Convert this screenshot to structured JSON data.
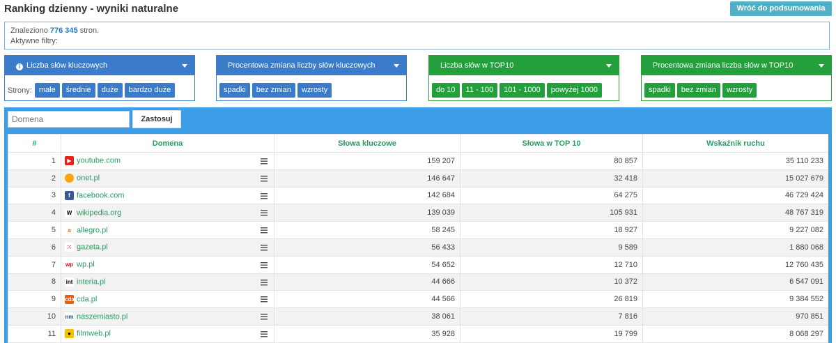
{
  "header": {
    "title": "Ranking dzienny - wyniki naturalne",
    "back_label": "Wróć do podsumowania"
  },
  "info": {
    "found_prefix": "Znaleziono ",
    "found_count": "776 345",
    "found_suffix": " stron.",
    "filters_label": "Aktywne filtry:"
  },
  "filters": [
    {
      "title": "Liczba słów kluczowych",
      "has_info": true,
      "prefix": "Strony:",
      "options": [
        "małe",
        "średnie",
        "duże",
        "bardzo duże"
      ]
    },
    {
      "title": "Procentowa zmiana liczby słów kluczowych",
      "has_info": false,
      "prefix": "",
      "options": [
        "spadki",
        "bez zmian",
        "wzrosty"
      ]
    },
    {
      "title": "Liczba słów w TOP10",
      "has_info": false,
      "prefix": "",
      "options": [
        "do 10",
        "11 - 100",
        "101 - 1000",
        "powyżej 1000"
      ]
    },
    {
      "title": "Procentowa zmiana liczba słów w TOP10",
      "has_info": false,
      "prefix": "",
      "options": [
        "spadki",
        "bez zmian",
        "wzrosty"
      ]
    }
  ],
  "search": {
    "placeholder": "Domena",
    "apply_label": "Zastosuj"
  },
  "table": {
    "columns": [
      "#",
      "Domena",
      "Słowa kluczowe",
      "Słowa w TOP 10",
      "Wskaźnik ruchu"
    ],
    "rows": [
      {
        "rank": "1",
        "domain": "youtube.com",
        "icon": "youtube-icon",
        "keywords": "159 207",
        "top10": "80 857",
        "traffic": "35 110 233"
      },
      {
        "rank": "2",
        "domain": "onet.pl",
        "icon": "onet-icon",
        "keywords": "146 647",
        "top10": "32 418",
        "traffic": "15 027 679"
      },
      {
        "rank": "3",
        "domain": "facebook.com",
        "icon": "facebook-icon",
        "keywords": "142 684",
        "top10": "64 275",
        "traffic": "46 729 424"
      },
      {
        "rank": "4",
        "domain": "wikipedia.org",
        "icon": "wikipedia-icon",
        "keywords": "139 039",
        "top10": "105 931",
        "traffic": "48 767 319"
      },
      {
        "rank": "5",
        "domain": "allegro.pl",
        "icon": "allegro-icon",
        "keywords": "58 245",
        "top10": "18 927",
        "traffic": "9 227 082"
      },
      {
        "rank": "6",
        "domain": "gazeta.pl",
        "icon": "gazeta-icon",
        "keywords": "56 433",
        "top10": "9 589",
        "traffic": "1 880 068"
      },
      {
        "rank": "7",
        "domain": "wp.pl",
        "icon": "wp-icon",
        "keywords": "54 652",
        "top10": "12 710",
        "traffic": "12 760 435"
      },
      {
        "rank": "8",
        "domain": "interia.pl",
        "icon": "interia-icon",
        "keywords": "44 666",
        "top10": "10 372",
        "traffic": "6 547 091"
      },
      {
        "rank": "9",
        "domain": "cda.pl",
        "icon": "cda-icon",
        "keywords": "44 566",
        "top10": "26 819",
        "traffic": "9 384 552"
      },
      {
        "rank": "10",
        "domain": "naszemiasto.pl",
        "icon": "naszemiasto-icon",
        "keywords": "38 061",
        "top10": "7 816",
        "traffic": "970 851"
      },
      {
        "rank": "11",
        "domain": "filmweb.pl",
        "icon": "filmweb-icon",
        "keywords": "35 928",
        "top10": "19 799",
        "traffic": "8 068 297"
      }
    ]
  },
  "icon_glyphs": {
    "youtube-icon": {
      "glyph": "▶",
      "bg": "#e62117",
      "fg": "#ffffff"
    },
    "onet-icon": {
      "glyph": "",
      "bg": "#ffa500",
      "fg": "#ffffff"
    },
    "facebook-icon": {
      "glyph": "f",
      "bg": "#3b5998",
      "fg": "#ffffff"
    },
    "wikipedia-icon": {
      "glyph": "W",
      "bg": "#ffffff",
      "fg": "#000000"
    },
    "allegro-icon": {
      "glyph": "a",
      "bg": "#ffffff",
      "fg": "#ff5a00"
    },
    "gazeta-icon": {
      "glyph": "⁙",
      "bg": "#ffffff",
      "fg": "#e2001a"
    },
    "wp-icon": {
      "glyph": "wp",
      "bg": "#ffffff",
      "fg": "#e3001b"
    },
    "interia-icon": {
      "glyph": "int",
      "bg": "#ffffff",
      "fg": "#000000"
    },
    "cda-icon": {
      "glyph": "cda",
      "bg": "#e95d0f",
      "fg": "#ffffff"
    },
    "naszemiasto-icon": {
      "glyph": "nm",
      "bg": "#ffffff",
      "fg": "#1b4f9c"
    },
    "filmweb-icon": {
      "glyph": "●",
      "bg": "#f2c200",
      "fg": "#000000"
    }
  }
}
